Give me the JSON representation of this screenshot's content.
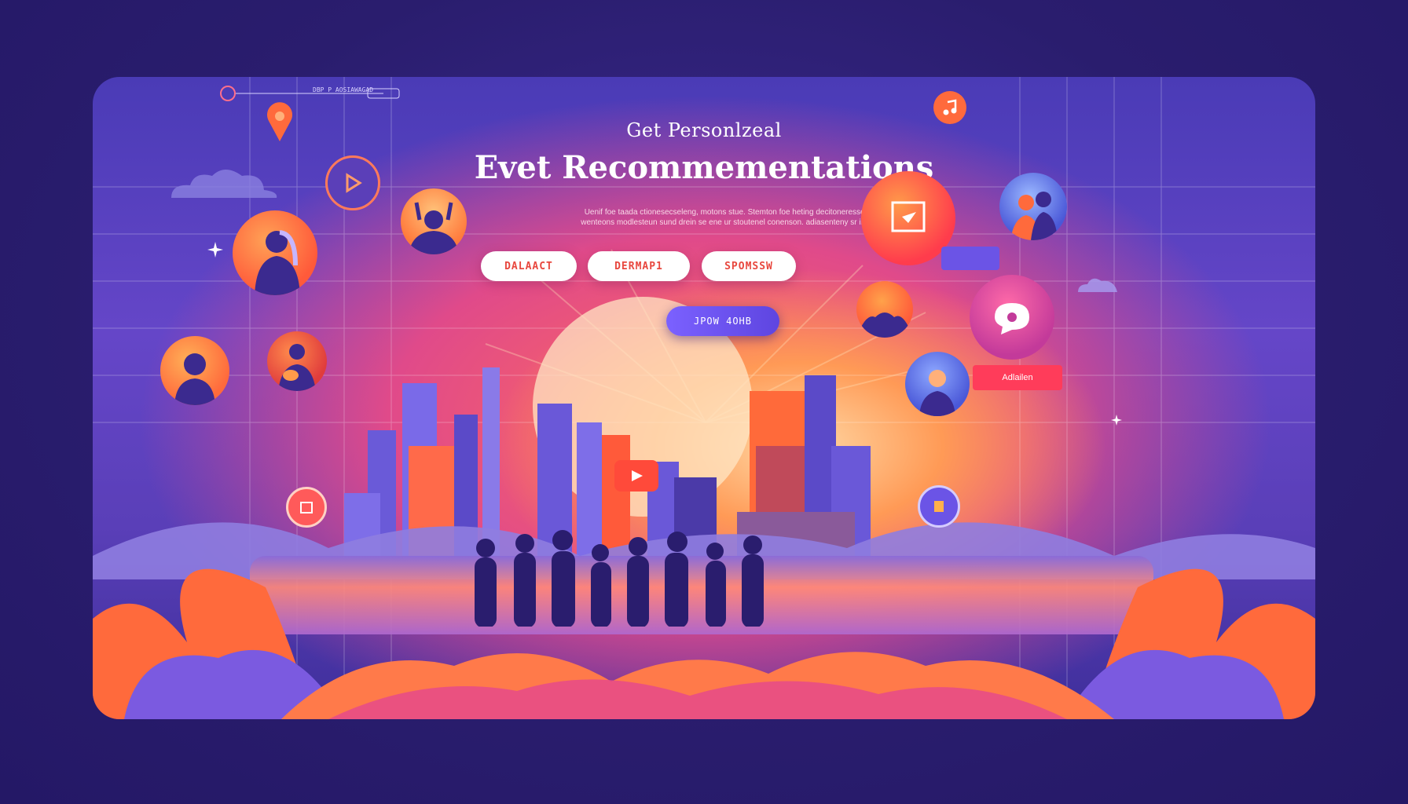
{
  "header": {
    "eyebrow": "Get Personlzeal",
    "title": "Evet Recommementations",
    "subtext_line1": "Uenif foe taada ctionesecseleng, motons stue. Stemton foe heting decitoneresseetnio",
    "subtext_line2": "wenteons modlesteun sund drein se ene ur stoutenel conenson. adiasenteny sr imoern.",
    "top_label": "DBP P AOSIAWAGAD"
  },
  "filters": [
    {
      "label": "DALAACT"
    },
    {
      "label": "DERMAP1"
    },
    {
      "label": "SPOMSSW"
    }
  ],
  "cta": {
    "label": "JPOW 4OHB"
  },
  "side_tag": {
    "label": "Adlailen"
  },
  "colors": {
    "background": "#2a1d6e",
    "accent_orange": "#ff7a3c",
    "accent_pink": "#e9468d",
    "accent_purple": "#6b4fe0",
    "pill_text": "#e8483f"
  },
  "icons": [
    "music-note-icon",
    "play-icon",
    "location-pin-icon",
    "heart-icon",
    "chat-icon",
    "cloud-icon",
    "sparkle-icon"
  ]
}
